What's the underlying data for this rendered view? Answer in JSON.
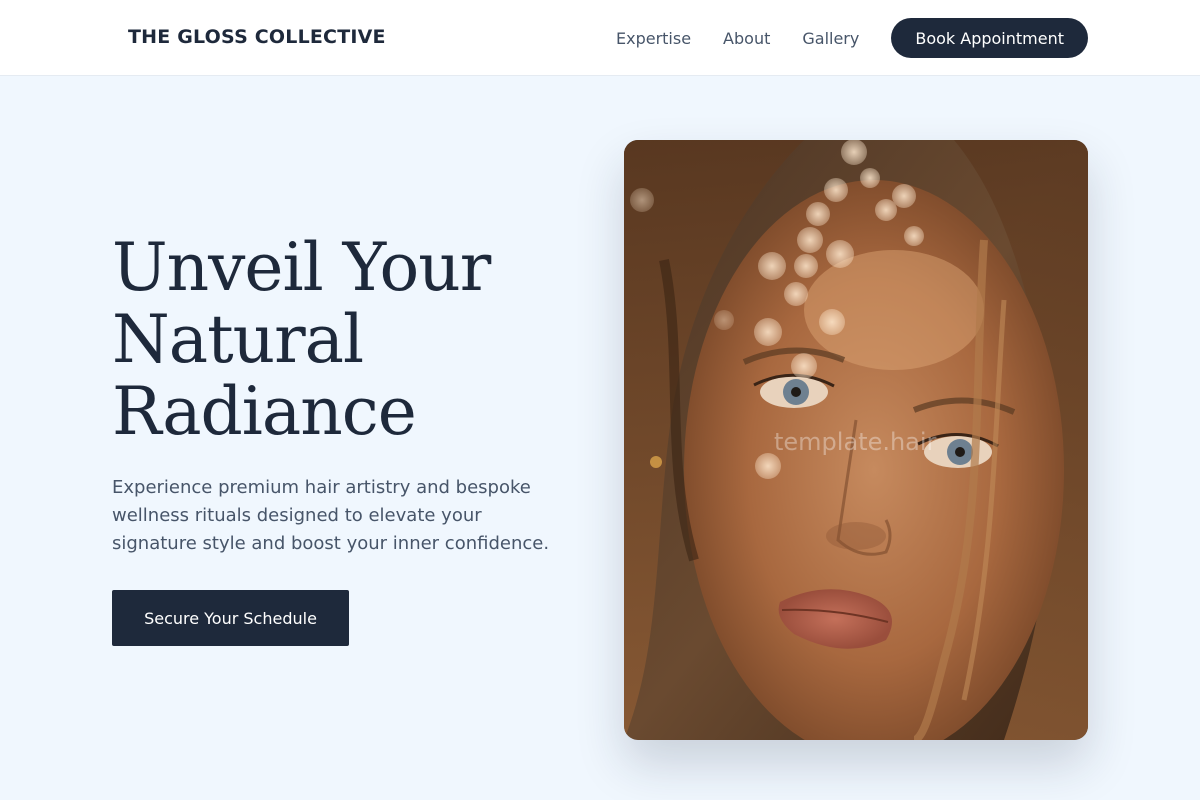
{
  "header": {
    "logo": "THE GLOSS COLLECTIVE",
    "nav": [
      {
        "label": "Expertise"
      },
      {
        "label": "About"
      },
      {
        "label": "Gallery"
      }
    ],
    "book_label": "Book Appointment"
  },
  "hero": {
    "title_lines": [
      "Unveil Your",
      "Natural",
      "Radiance"
    ],
    "description": "Experience premium hair artistry and bespoke wellness rituals designed to elevate your signature style and boost your inner confidence.",
    "cta_label": "Secure Your Schedule"
  },
  "photo": {
    "watermark": "template.hair"
  },
  "colors": {
    "background": "#f0f7fe",
    "primary_dark": "#1e293b",
    "text_muted": "#475569"
  }
}
